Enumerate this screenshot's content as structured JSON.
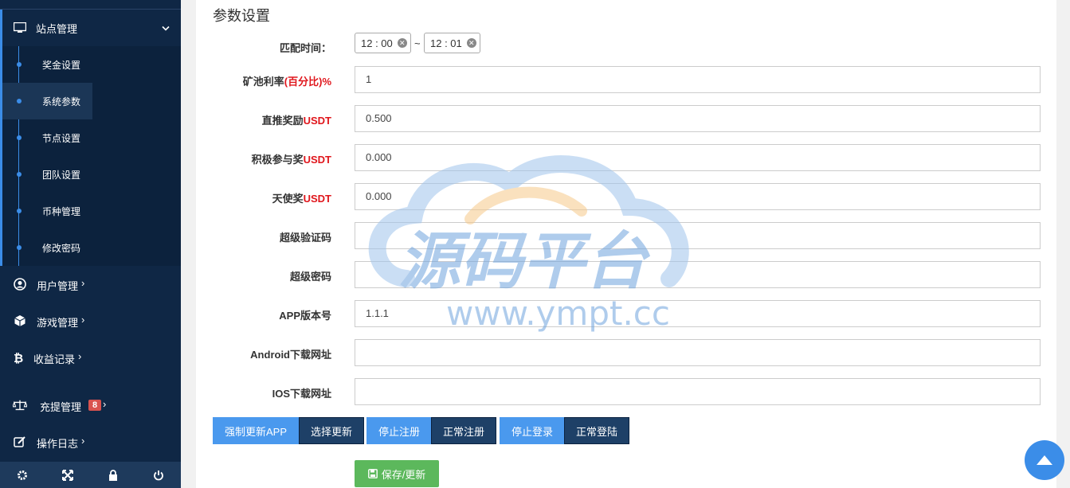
{
  "sidebar": {
    "parent": {
      "label": "站点管理",
      "icon": "monitor-icon"
    },
    "subitems": [
      {
        "label": "奖金设置"
      },
      {
        "label": "系统参数",
        "active": true
      },
      {
        "label": "节点设置"
      },
      {
        "label": "团队设置"
      },
      {
        "label": "币种管理"
      },
      {
        "label": "修改密码"
      }
    ],
    "items": [
      {
        "label": "用户管理",
        "icon": "user-circle-icon"
      },
      {
        "label": "游戏管理",
        "icon": "cube-icon"
      },
      {
        "label": "收益记录",
        "icon": "bitcoin-icon"
      },
      {
        "label": "充提管理",
        "icon": "balance-scale-icon",
        "badge": "8"
      },
      {
        "label": "操作日志",
        "icon": "edit-icon"
      }
    ],
    "bottom": [
      "gear-icon",
      "expand-icon",
      "lock-icon",
      "power-icon"
    ]
  },
  "panel": {
    "title": "参数设置",
    "match_time": {
      "label": "匹配时间：",
      "start": "12 : 00",
      "end": "12 : 01",
      "separator": "~"
    },
    "fields": [
      {
        "label": "矿池利率",
        "red": "(百分比)%",
        "value": "1"
      },
      {
        "label": "直推奖励",
        "red": "USDT",
        "value": "0.500"
      },
      {
        "label": "积极参与奖",
        "red": "USDT",
        "value": "0.000"
      },
      {
        "label": "天使奖",
        "red": "USDT",
        "value": "0.000"
      },
      {
        "label": "超级验证码",
        "red": "",
        "value": ""
      },
      {
        "label": "超级密码",
        "red": "",
        "value": ""
      },
      {
        "label": "APP版本号",
        "red": "",
        "value": "1.1.1"
      },
      {
        "label": "Android下载网址",
        "red": "",
        "value": ""
      },
      {
        "label": "IOS下载网址",
        "red": "",
        "value": ""
      }
    ],
    "actions": [
      "强制更新APP",
      "选择更新",
      "停止注册",
      "正常注册",
      "停止登录",
      "正常登陆"
    ],
    "save_label": "保存/更新"
  },
  "watermark": {
    "title": "源码平台",
    "url": "www.ympt.cc"
  },
  "colors": {
    "sidebar": "#0f2745",
    "accent": "#3b8de8",
    "red": "#e0161c",
    "save": "#5cb85c"
  }
}
